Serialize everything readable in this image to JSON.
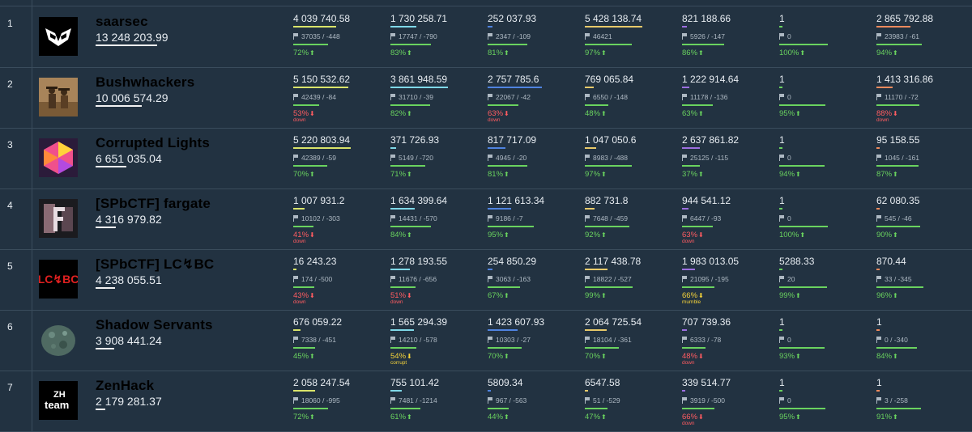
{
  "columns": [
    {
      "bar_color": "#d9e46a"
    },
    {
      "bar_color": "#7fd8e8"
    },
    {
      "bar_color": "#4f83e0"
    },
    {
      "bar_color": "#e7c96a"
    },
    {
      "bar_color": "#9c6fe0"
    },
    {
      "bar_color": "#6ad35f"
    },
    {
      "bar_color": "#f08a5d"
    }
  ],
  "teams": [
    {
      "rank": "1",
      "name": "saarsec",
      "score": "13 248 203.99",
      "score_ratio": 1.0,
      "logo": "owl-mask-logo",
      "services": [
        {
          "value": "4 039 740.58",
          "share": 0.74,
          "flags": "37035 / -448",
          "sla": "72%",
          "sla_ratio": 0.72,
          "state": "up",
          "status": ""
        },
        {
          "value": "1 730 258.71",
          "share": 0.45,
          "flags": "17747 / -790",
          "sla": "83%",
          "sla_ratio": 0.83,
          "state": "up",
          "status": ""
        },
        {
          "value": "252 037.93",
          "share": 0.09,
          "flags": "2347 / -109",
          "sla": "81%",
          "sla_ratio": 0.81,
          "state": "up",
          "status": ""
        },
        {
          "value": "5 428 138.74",
          "share": 0.98,
          "flags": "46421",
          "sla": "97%",
          "sla_ratio": 0.97,
          "state": "up",
          "status": ""
        },
        {
          "value": "821 188.66",
          "share": 0.09,
          "flags": "5926 / -147",
          "sla": "86%",
          "sla_ratio": 0.86,
          "state": "up",
          "status": ""
        },
        {
          "value": "1",
          "share": 0.0,
          "flags": "0",
          "sla": "100%",
          "sla_ratio": 1.0,
          "state": "up",
          "status": ""
        },
        {
          "value": "2 865 792.88",
          "share": 0.58,
          "flags": "23983 / -61",
          "sla": "94%",
          "sla_ratio": 0.94,
          "state": "up",
          "status": ""
        }
      ]
    },
    {
      "rank": "2",
      "name": "Bushwhackers",
      "score": "10 006 574.29",
      "score_ratio": 0.75,
      "logo": "cowboys-photo-logo",
      "services": [
        {
          "value": "5 150 532.62",
          "share": 0.94,
          "flags": "42439 / -84",
          "sla": "53%",
          "sla_ratio": 0.53,
          "state": "down",
          "status": "down"
        },
        {
          "value": "3 861 948.59",
          "share": 0.98,
          "flags": "31710 / -39",
          "sla": "82%",
          "sla_ratio": 0.82,
          "state": "up",
          "status": ""
        },
        {
          "value": "2 757 785.6",
          "share": 0.93,
          "flags": "22067 / -42",
          "sla": "63%",
          "sla_ratio": 0.63,
          "state": "down",
          "status": "down"
        },
        {
          "value": "769 065.84",
          "share": 0.15,
          "flags": "6550 / -148",
          "sla": "48%",
          "sla_ratio": 0.48,
          "state": "up",
          "status": ""
        },
        {
          "value": "1 222 914.64",
          "share": 0.13,
          "flags": "11178 / -136",
          "sla": "63%",
          "sla_ratio": 0.63,
          "state": "up",
          "status": ""
        },
        {
          "value": "1",
          "share": 0.0,
          "flags": "0",
          "sla": "95%",
          "sla_ratio": 0.95,
          "state": "up",
          "status": ""
        },
        {
          "value": "1 413 316.86",
          "share": 0.28,
          "flags": "11170 / -72",
          "sla": "88%",
          "sla_ratio": 0.88,
          "state": "down",
          "status": "down"
        }
      ]
    },
    {
      "rank": "3",
      "name": "Corrupted Lights",
      "score": "6 651 035.04",
      "score_ratio": 0.5,
      "logo": "hexagon-logo",
      "services": [
        {
          "value": "5 220 803.94",
          "share": 0.98,
          "flags": "42389 / -59",
          "sla": "70%",
          "sla_ratio": 0.7,
          "state": "up",
          "status": ""
        },
        {
          "value": "371 726.93",
          "share": 0.1,
          "flags": "5149 / -720",
          "sla": "71%",
          "sla_ratio": 0.71,
          "state": "up",
          "status": ""
        },
        {
          "value": "817 717.09",
          "share": 0.3,
          "flags": "4945 / -20",
          "sla": "81%",
          "sla_ratio": 0.81,
          "state": "up",
          "status": ""
        },
        {
          "value": "1 047 050.6",
          "share": 0.2,
          "flags": "8983 / -488",
          "sla": "97%",
          "sla_ratio": 0.97,
          "state": "up",
          "status": ""
        },
        {
          "value": "2 637 861.82",
          "share": 0.3,
          "flags": "25125 / -115",
          "sla": "37%",
          "sla_ratio": 0.37,
          "state": "up",
          "status": ""
        },
        {
          "value": "1",
          "share": 0.0,
          "flags": "0",
          "sla": "94%",
          "sla_ratio": 0.94,
          "state": "up",
          "status": ""
        },
        {
          "value": "95 158.55",
          "share": 0.02,
          "flags": "1045 / -161",
          "sla": "87%",
          "sla_ratio": 0.87,
          "state": "up",
          "status": ""
        }
      ]
    },
    {
      "rank": "4",
      "name": "[SPbCTF] fargate",
      "score": "4 316 979.82",
      "score_ratio": 0.33,
      "logo": "letter-f-logo",
      "services": [
        {
          "value": "1 007 931.2",
          "share": 0.19,
          "flags": "10102 / -303",
          "sla": "41%",
          "sla_ratio": 0.41,
          "state": "down",
          "status": "down"
        },
        {
          "value": "1 634 399.64",
          "share": 0.42,
          "flags": "14431 / -570",
          "sla": "84%",
          "sla_ratio": 0.84,
          "state": "up",
          "status": ""
        },
        {
          "value": "1 121 613.34",
          "share": 0.4,
          "flags": "9186 / -7",
          "sla": "95%",
          "sla_ratio": 0.95,
          "state": "up",
          "status": ""
        },
        {
          "value": "882 731.8",
          "share": 0.17,
          "flags": "7648 / -459",
          "sla": "92%",
          "sla_ratio": 0.92,
          "state": "up",
          "status": ""
        },
        {
          "value": "944 541.12",
          "share": 0.11,
          "flags": "6447 / -93",
          "sla": "63%",
          "sla_ratio": 0.63,
          "state": "down",
          "status": "down"
        },
        {
          "value": "1",
          "share": 0.0,
          "flags": "0",
          "sla": "100%",
          "sla_ratio": 1.0,
          "state": "up",
          "status": ""
        },
        {
          "value": "62 080.35",
          "share": 0.02,
          "flags": "545 / -46",
          "sla": "90%",
          "sla_ratio": 0.9,
          "state": "up",
          "status": ""
        }
      ]
    },
    {
      "rank": "5",
      "name": "[SPbCTF] LC↯BC",
      "score": "4 238 055.51",
      "score_ratio": 0.32,
      "logo": "lcbc-logo",
      "services": [
        {
          "value": "16 243.23",
          "share": 0.01,
          "flags": "174 / -500",
          "sla": "43%",
          "sla_ratio": 0.43,
          "state": "down",
          "status": "down"
        },
        {
          "value": "1 278 193.55",
          "share": 0.33,
          "flags": "11676 / -656",
          "sla": "51%",
          "sla_ratio": 0.51,
          "state": "down",
          "status": "down"
        },
        {
          "value": "254 850.29",
          "share": 0.09,
          "flags": "3063 / -163",
          "sla": "67%",
          "sla_ratio": 0.67,
          "state": "up",
          "status": ""
        },
        {
          "value": "2 117 438.78",
          "share": 0.39,
          "flags": "18822 / -527",
          "sla": "99%",
          "sla_ratio": 0.99,
          "state": "up",
          "status": ""
        },
        {
          "value": "1 983 013.05",
          "share": 0.22,
          "flags": "21095 / -195",
          "sla": "66%",
          "sla_ratio": 0.66,
          "state": "warn",
          "status": "mumble"
        },
        {
          "value": "5288.33",
          "share": 0.0,
          "flags": "20",
          "sla": "99%",
          "sla_ratio": 0.99,
          "state": "up",
          "status": ""
        },
        {
          "value": "870.44",
          "share": 0.0,
          "flags": "33 / -345",
          "sla": "96%",
          "sla_ratio": 0.96,
          "state": "up",
          "status": ""
        }
      ]
    },
    {
      "rank": "6",
      "name": "Shadow Servants",
      "score": "3 908 441.24",
      "score_ratio": 0.3,
      "logo": "stone-globe-logo",
      "services": [
        {
          "value": "676 059.22",
          "share": 0.13,
          "flags": "7338 / -451",
          "sla": "45%",
          "sla_ratio": 0.45,
          "state": "up",
          "status": ""
        },
        {
          "value": "1 565 294.39",
          "share": 0.4,
          "flags": "14210 / -578",
          "sla": "54%",
          "sla_ratio": 0.54,
          "state": "warn",
          "status": "corrupt"
        },
        {
          "value": "1 423 607.93",
          "share": 0.51,
          "flags": "10303 / -27",
          "sla": "70%",
          "sla_ratio": 0.7,
          "state": "up",
          "status": ""
        },
        {
          "value": "2 064 725.54",
          "share": 0.38,
          "flags": "18104 / -361",
          "sla": "70%",
          "sla_ratio": 0.7,
          "state": "up",
          "status": ""
        },
        {
          "value": "707 739.36",
          "share": 0.08,
          "flags": "6333 / -78",
          "sla": "48%",
          "sla_ratio": 0.48,
          "state": "down",
          "status": "down"
        },
        {
          "value": "1",
          "share": 0.0,
          "flags": "0",
          "sla": "93%",
          "sla_ratio": 0.93,
          "state": "up",
          "status": ""
        },
        {
          "value": "1",
          "share": 0.0,
          "flags": "0 / -340",
          "sla": "84%",
          "sla_ratio": 0.84,
          "state": "up",
          "status": ""
        }
      ]
    },
    {
      "rank": "7",
      "name": "ZenHack",
      "score": "2 179 281.37",
      "score_ratio": 0.16,
      "logo": "zenhack-team-logo",
      "services": [
        {
          "value": "2 058 247.54",
          "share": 0.38,
          "flags": "18060 / -995",
          "sla": "72%",
          "sla_ratio": 0.72,
          "state": "up",
          "status": ""
        },
        {
          "value": "755 101.42",
          "share": 0.19,
          "flags": "7481 / -1214",
          "sla": "61%",
          "sla_ratio": 0.61,
          "state": "up",
          "status": ""
        },
        {
          "value": "5809.34",
          "share": 0.0,
          "flags": "967 / -563",
          "sla": "44%",
          "sla_ratio": 0.44,
          "state": "up",
          "status": ""
        },
        {
          "value": "6547.58",
          "share": 0.0,
          "flags": "51 / -529",
          "sla": "47%",
          "sla_ratio": 0.47,
          "state": "up",
          "status": ""
        },
        {
          "value": "339 514.77",
          "share": 0.04,
          "flags": "3919 / -500",
          "sla": "66%",
          "sla_ratio": 0.66,
          "state": "down",
          "status": "down"
        },
        {
          "value": "1",
          "share": 0.0,
          "flags": "0",
          "sla": "95%",
          "sla_ratio": 0.95,
          "state": "up",
          "status": ""
        },
        {
          "value": "1",
          "share": 0.0,
          "flags": "3 / -258",
          "sla": "91%",
          "sla_ratio": 0.91,
          "state": "up",
          "status": ""
        }
      ]
    }
  ]
}
